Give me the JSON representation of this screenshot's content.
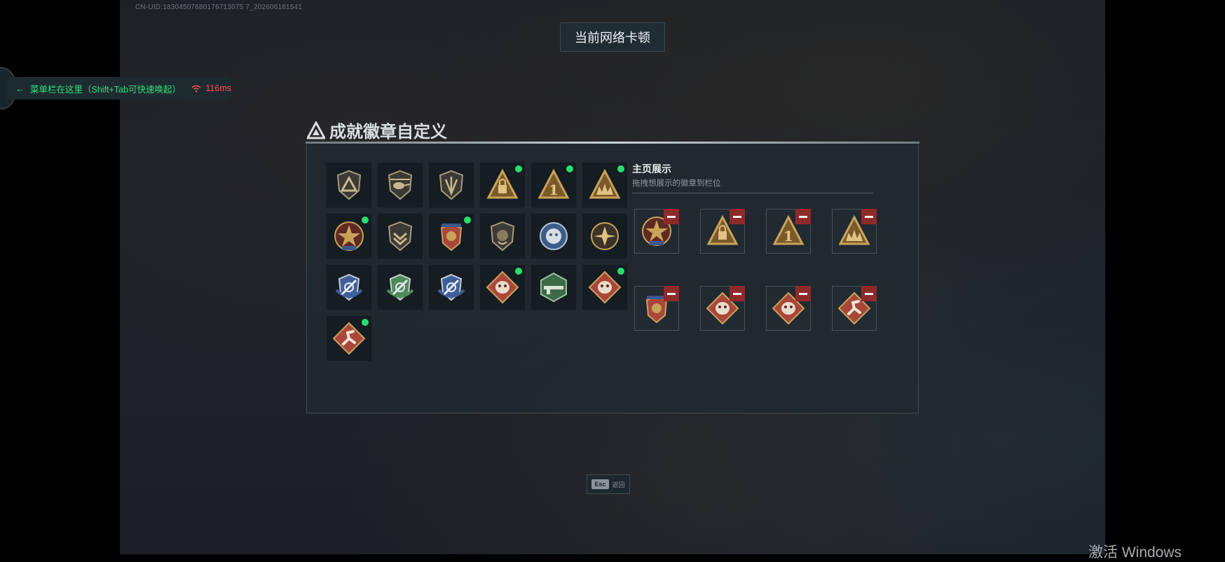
{
  "uid_text": "CN-UID:18304507680176713075 7_202606181541",
  "network_toast": "当前网络卡顿",
  "menu_hint": {
    "arrow": "←",
    "text": "菜单栏在这里（Shift+Tab可快速唤起）",
    "latency": "116ms",
    "latency_color": "#ff4d4d",
    "text_color": "#33e07a"
  },
  "panel": {
    "title": "成就徽章自定义"
  },
  "badges": [
    {
      "icon": "shield-triangle-icon",
      "new": false
    },
    {
      "icon": "helicopter-icon",
      "new": false
    },
    {
      "icon": "shield-arrow-icon",
      "new": false
    },
    {
      "icon": "gold-triangle-lock-icon",
      "new": true
    },
    {
      "icon": "gold-triangle-number-one-icon",
      "new": true
    },
    {
      "icon": "gold-triangle-soldiers-icon",
      "new": true
    },
    {
      "icon": "star-medal-icon",
      "new": true
    },
    {
      "icon": "chevron-shield-icon",
      "new": false
    },
    {
      "icon": "eagle-star-shield-icon",
      "new": true
    },
    {
      "icon": "lion-shield-icon",
      "new": false
    },
    {
      "icon": "wolf-emblem-icon",
      "new": false
    },
    {
      "icon": "sun-eagle-icon",
      "new": false
    },
    {
      "icon": "blue-wings-crest-icon",
      "new": false
    },
    {
      "icon": "green-wings-crest-icon",
      "new": false
    },
    {
      "icon": "blue-wings-crest-2-icon",
      "new": false
    },
    {
      "icon": "red-diamond-wolf-icon",
      "new": true
    },
    {
      "icon": "green-hex-rifle-icon",
      "new": false
    },
    {
      "icon": "red-diamond-dragon-icon",
      "new": true
    },
    {
      "icon": "red-diamond-runner-icon",
      "new": true
    }
  ],
  "showcase": {
    "title": "主页展示",
    "subtitle": "拖拽想展示的徽章到栏位",
    "slots": [
      {
        "icon": "star-medal-icon"
      },
      {
        "icon": "gold-triangle-lock-icon"
      },
      {
        "icon": "gold-triangle-number-one-icon"
      },
      {
        "icon": "gold-triangle-soldiers-icon"
      },
      {
        "icon": "eagle-star-shield-icon"
      },
      {
        "icon": "red-diamond-dragon-icon"
      },
      {
        "icon": "red-diamond-wolf-icon"
      },
      {
        "icon": "red-diamond-runner-icon"
      }
    ]
  },
  "footer": {
    "esc_key": "Esc",
    "esc_label": "返回"
  },
  "watermark": "激活 Windows"
}
